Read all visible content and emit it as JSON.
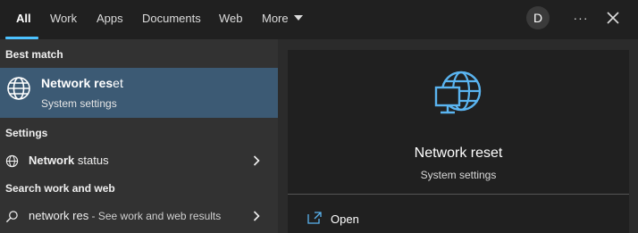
{
  "tabs": [
    {
      "label": "All",
      "active": true
    },
    {
      "label": "Work",
      "active": false
    },
    {
      "label": "Apps",
      "active": false
    },
    {
      "label": "Documents",
      "active": false
    },
    {
      "label": "Web",
      "active": false
    },
    {
      "label": "More",
      "active": false
    }
  ],
  "avatar_initial": "D",
  "overflow_label": "···",
  "colors": {
    "accent": "#4cc2ff",
    "selected_row": "#3c5a74",
    "icon_blue": "#5ab4f0"
  },
  "left": {
    "best_match_header": "Best match",
    "best_match": {
      "title_bold": "Network res",
      "title_rest": "et",
      "subtitle": "System settings",
      "icon": "globe-icon"
    },
    "settings_header": "Settings",
    "settings_item": {
      "label_bold": "Network",
      "label_rest": " status",
      "icon": "globe-icon"
    },
    "web_header": "Search work and web",
    "web_item": {
      "query": "network res",
      "suffix": " - See work and web results",
      "icon": "search-icon"
    }
  },
  "preview": {
    "title": "Network reset",
    "subtitle": "System settings",
    "icon": "network-reset-icon",
    "actions": [
      {
        "label": "Open",
        "icon": "open-icon"
      }
    ]
  }
}
